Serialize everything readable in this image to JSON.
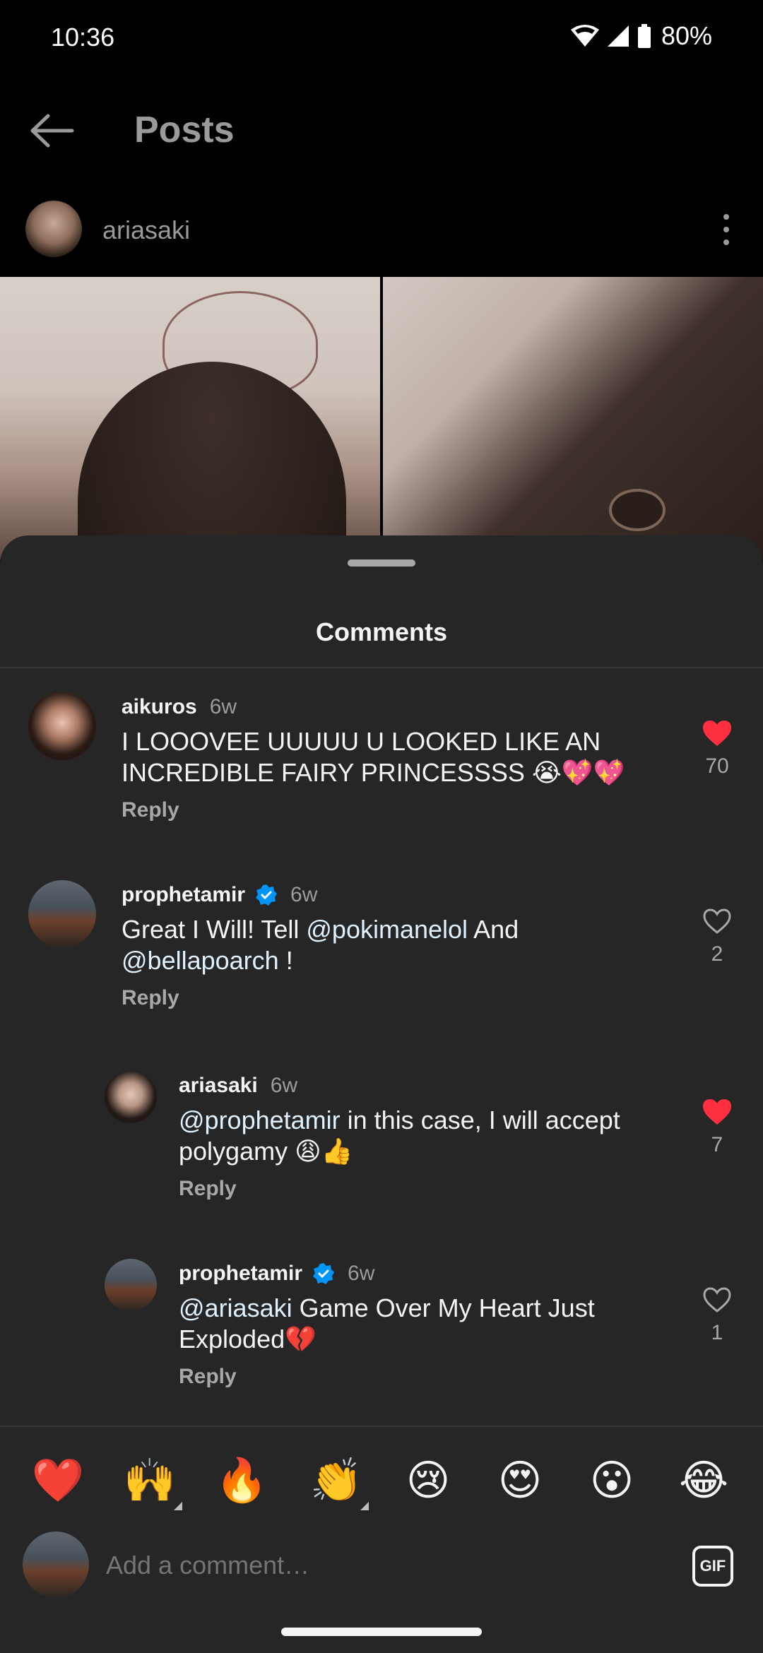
{
  "status_bar": {
    "time": "10:36",
    "battery_percent": "80%"
  },
  "header": {
    "title": "Posts"
  },
  "post": {
    "username": "ariasaki"
  },
  "comments_sheet": {
    "title": "Comments",
    "comments": [
      {
        "username": "aikuros",
        "time": "6w",
        "verified": false,
        "text": "I LOOOVEE UUUUU U LOOKED LIKE AN INCREDIBLE FAIRY PRINCESSSS 😭💖💖",
        "reply_label": "Reply",
        "likes": "70",
        "liked": true
      },
      {
        "username": "prophetamir",
        "time": "6w",
        "verified": true,
        "text_parts": [
          "Great I Will! Tell ",
          "@pokimanelol",
          " And ",
          "@bellapoarch",
          " !"
        ],
        "reply_label": "Reply",
        "likes": "2",
        "liked": false
      },
      {
        "username": "ariasaki",
        "time": "6w",
        "verified": false,
        "text_parts": [
          "@prophetamir",
          " in this case, I will accept polygamy 😩👍"
        ],
        "reply_label": "Reply",
        "likes": "7",
        "liked": true
      },
      {
        "username": "prophetamir",
        "time": "6w",
        "verified": true,
        "text_parts": [
          "@ariasaki",
          " Game Over My Heart Just Exploded💔"
        ],
        "reply_label": "Reply",
        "likes": "1",
        "liked": false
      }
    ]
  },
  "emoji_bar": [
    "❤️",
    "🙌",
    "🔥",
    "👏",
    "😢",
    "😍",
    "😮",
    "😂"
  ],
  "composer": {
    "placeholder": "Add a comment…",
    "gif_label": "GIF"
  },
  "colors": {
    "like_red": "#ff3040",
    "verified_blue": "#0095f6",
    "sheet_bg": "#262626"
  }
}
